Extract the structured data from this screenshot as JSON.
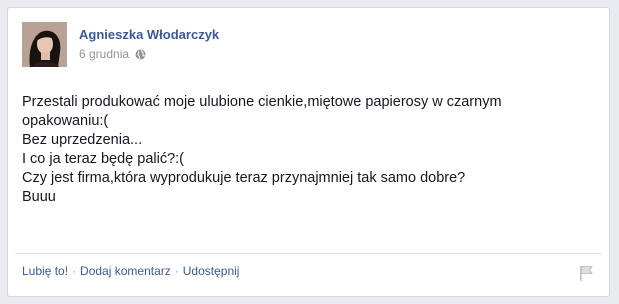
{
  "post": {
    "author": "Agnieszka Włodarczyk",
    "date": "6 grudnia",
    "privacy_icon": "globe-icon",
    "lines": [
      "Przestali produkować moje ulubione cienkie,miętowe papierosy w czarnym",
      "opakowaniu:(",
      "Bez uprzedzenia...",
      "I co ja teraz będę palić?:(",
      "Czy jest firma,która wyprodukuje teraz przynajmniej tak samo dobre?",
      "Buuu"
    ]
  },
  "actions": {
    "like": "Lubię to!",
    "separator": "·",
    "comment": "Dodaj komentarz",
    "share": "Udostępnij",
    "flag_icon": "flag-icon"
  },
  "colors": {
    "link": "#3b5998",
    "meta": "#90949c",
    "text": "#141823",
    "background": "#e9ebee"
  }
}
